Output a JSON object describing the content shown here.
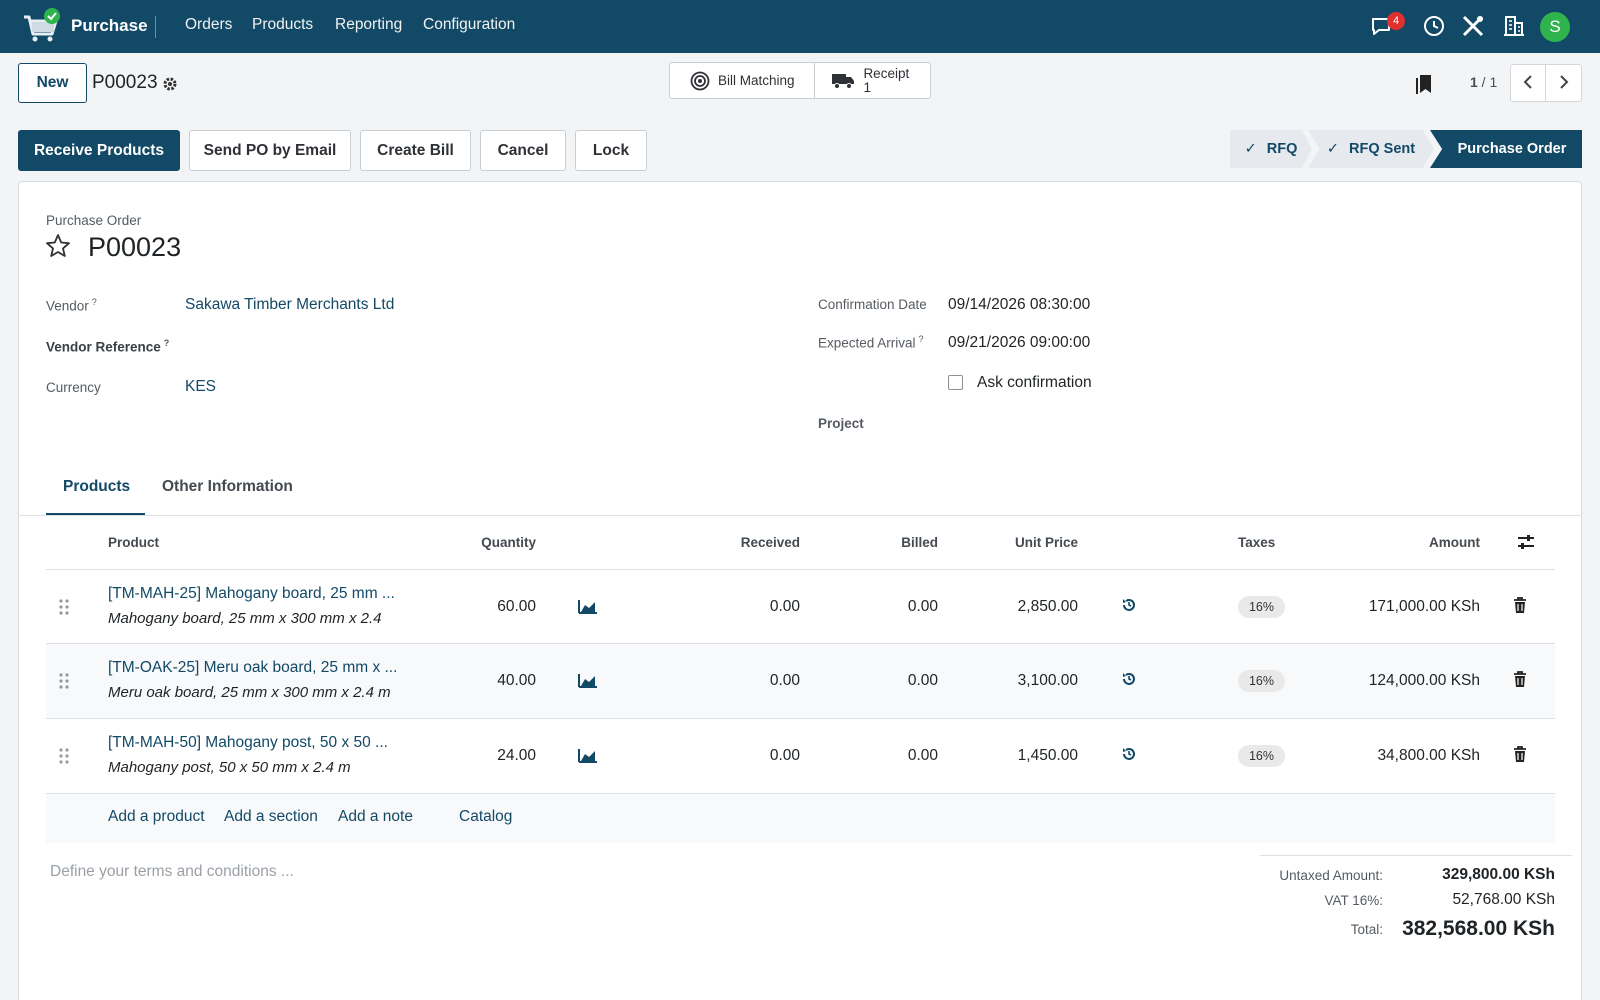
{
  "navbar": {
    "app_name": "Purchase",
    "menus": [
      "Orders",
      "Products",
      "Reporting",
      "Configuration"
    ],
    "notification_count": "4",
    "avatar_letter": "S"
  },
  "control_panel": {
    "new_label": "New",
    "breadcrumb": "P00023",
    "smart_buttons": {
      "bill_matching": "Bill Matching",
      "receipt_label": "Receipt",
      "receipt_count": "1"
    },
    "pager": {
      "current": "1",
      "total": "1"
    }
  },
  "actions": [
    "Receive Products",
    "Send PO by Email",
    "Create Bill",
    "Cancel",
    "Lock"
  ],
  "statusbar": {
    "steps": [
      "RFQ",
      "RFQ Sent",
      "Purchase Order"
    ],
    "check": "✓"
  },
  "form": {
    "title_label": "Purchase Order",
    "title": "P00023",
    "vendor_label": "Vendor",
    "vendor": "Sakawa Timber Merchants Ltd",
    "vendor_ref_label": "Vendor Reference",
    "currency_label": "Currency",
    "currency": "KES",
    "confirmation_date_label": "Confirmation Date",
    "confirmation_date": "09/14/2026 08:30:00",
    "expected_arrival_label": "Expected Arrival",
    "expected_arrival": "09/21/2026 09:00:00",
    "ask_confirmation_label": "Ask confirmation",
    "project_label": "Project",
    "help_mark": "?"
  },
  "tabs": [
    "Products",
    "Other Information"
  ],
  "table": {
    "headers": [
      "Product",
      "Quantity",
      "Received",
      "Billed",
      "Unit Price",
      "Taxes",
      "Amount"
    ],
    "rows": [
      {
        "name": "[TM-MAH-25] Mahogany board, 25 mm ...",
        "desc": "Mahogany board, 25 mm x 300 mm x 2.4",
        "qty": "60.00",
        "received": "0.00",
        "billed": "0.00",
        "price": "2,850.00",
        "tax": "16%",
        "amount": "171,000.00 KSh"
      },
      {
        "name": "[TM-OAK-25] Meru oak board, 25 mm x ...",
        "desc": "Meru oak board, 25 mm x 300 mm x 2.4 m",
        "qty": "40.00",
        "received": "0.00",
        "billed": "0.00",
        "price": "3,100.00",
        "tax": "16%",
        "amount": "124,000.00 KSh"
      },
      {
        "name": "[TM-MAH-50] Mahogany post, 50 x 50 ...",
        "desc": "Mahogany post, 50 x 50 mm x 2.4 m",
        "qty": "24.00",
        "received": "0.00",
        "billed": "0.00",
        "price": "1,450.00",
        "tax": "16%",
        "amount": "34,800.00 KSh"
      }
    ],
    "add_links": [
      "Add a product",
      "Add a section",
      "Add a note",
      "Catalog"
    ]
  },
  "terms_placeholder": "Define your terms and conditions ...",
  "totals": {
    "untaxed_label": "Untaxed Amount:",
    "untaxed": "329,800.00 KSh",
    "vat_label": "VAT 16%:",
    "vat": "52,768.00 KSh",
    "total_label": "Total:",
    "total": "382,568.00 KSh"
  }
}
